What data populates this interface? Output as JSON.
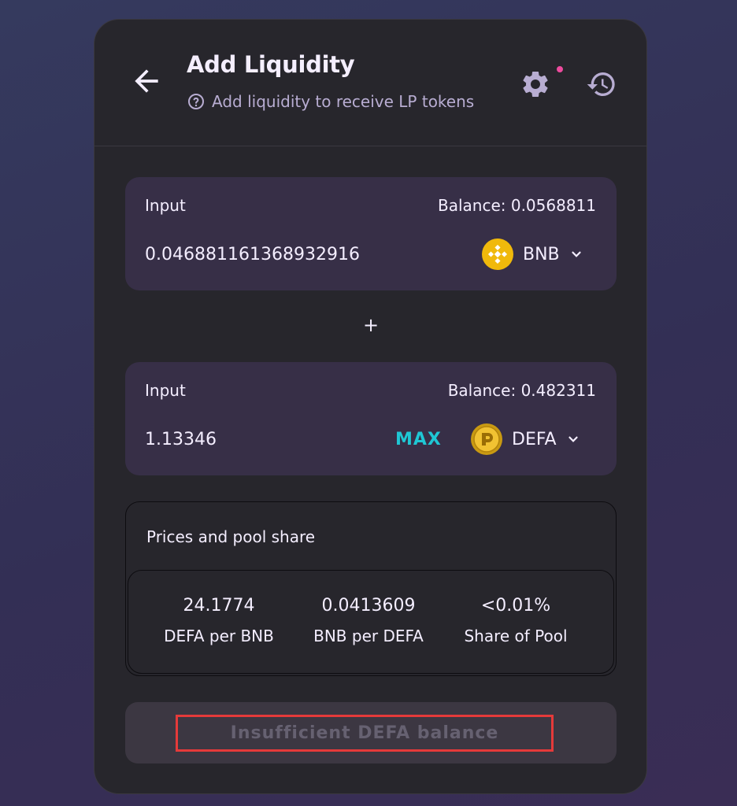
{
  "header": {
    "title": "Add Liquidity",
    "subtitle": "Add liquidity to receive LP tokens"
  },
  "input_a": {
    "label": "Input",
    "balance": "Balance: 0.0568811",
    "amount": "0.046881161368932916",
    "token": "BNB",
    "token_icon": "bnb-coin-icon"
  },
  "plus": "+",
  "input_b": {
    "label": "Input",
    "balance": "Balance: 0.482311",
    "amount": "1.13346",
    "max_label": "MAX",
    "token": "DEFA",
    "token_icon": "defa-coin-icon"
  },
  "prices": {
    "heading": "Prices and pool share",
    "items": [
      {
        "value": "24.1774",
        "label": "DEFA per BNB"
      },
      {
        "value": "0.0413609",
        "label": "BNB per DEFA"
      },
      {
        "value": "<0.01%",
        "label": "Share of Pool"
      }
    ]
  },
  "action": {
    "label": "Insufficient DEFA balance"
  },
  "colors": {
    "card_bg": "#27262c",
    "input_bg": "#372f47",
    "accent": "#1fc7d4",
    "notification_dot": "#ed4b9e",
    "highlight_border": "#e53a3a"
  }
}
